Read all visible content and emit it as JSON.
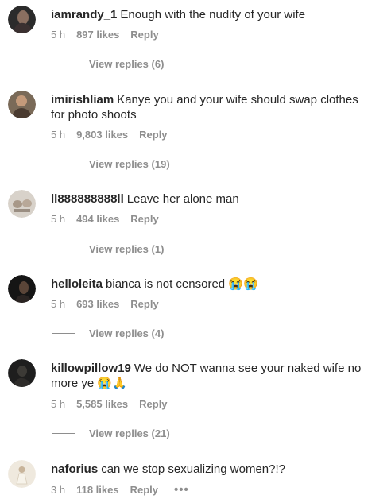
{
  "comments": [
    {
      "username": "iamrandy_1",
      "text": "Enough with the nudity of your wife",
      "time": "5 h",
      "likes": "897 likes",
      "reply_label": "Reply",
      "view_replies": "View replies (6)",
      "avatar_color": "#2b2b2b"
    },
    {
      "username": "imirishliam",
      "text": "Kanye you and your wife should swap clothes for photo shoots",
      "time": "5 h",
      "likes": "9,803 likes",
      "reply_label": "Reply",
      "view_replies": "View replies (19)",
      "avatar_color": "#6b5a4a"
    },
    {
      "username": "ll888888888ll",
      "text": "Leave her alone man",
      "time": "5 h",
      "likes": "494 likes",
      "reply_label": "Reply",
      "view_replies": "View replies (1)",
      "avatar_color": "#c9c2ba"
    },
    {
      "username": "helloleita",
      "text": "bianca is not censored 😭😭",
      "time": "5 h",
      "likes": "693 likes",
      "reply_label": "Reply",
      "view_replies": "View replies (4)",
      "avatar_color": "#1a1a1a"
    },
    {
      "username": "killowpillow19",
      "text": "We do NOT wanna see your naked wife no more ye 😭🙏",
      "time": "5 h",
      "likes": "5,585 likes",
      "reply_label": "Reply",
      "view_replies": "View replies (21)",
      "avatar_color": "#222222"
    },
    {
      "username": "naforius",
      "text": "can we stop sexualizing women?!?",
      "time": "3 h",
      "likes": "118 likes",
      "reply_label": "Reply",
      "more_label": "•••",
      "avatar_color": "#ebe6dc"
    }
  ]
}
